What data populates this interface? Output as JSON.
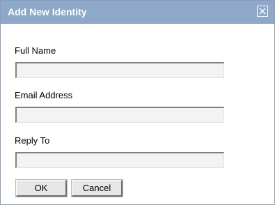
{
  "dialog": {
    "title": "Add New Identity",
    "close_icon": "close-icon"
  },
  "form": {
    "full_name": {
      "label": "Full Name",
      "value": ""
    },
    "email_address": {
      "label": "Email Address",
      "value": ""
    },
    "reply_to": {
      "label": "Reply To",
      "value": ""
    }
  },
  "buttons": {
    "ok_label": "OK",
    "cancel_label": "Cancel"
  },
  "colors": {
    "titlebar": "#8ea8c9",
    "title_text": "#ffffff",
    "field_background": "#f3f3f3",
    "button_face": "#e7e7e7"
  }
}
